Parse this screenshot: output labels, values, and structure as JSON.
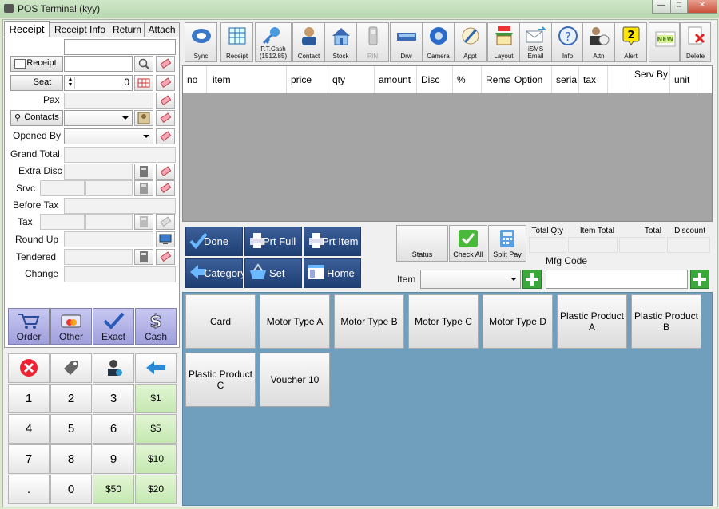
{
  "window": {
    "title": "POS Terminal (kyy)",
    "minimize": "—",
    "maximize": "□",
    "close": "✕"
  },
  "left": {
    "tabs": [
      "Receipt",
      "Receipt Info",
      "Return",
      "Attach"
    ],
    "receipt_button": "Receipt",
    "seat_button": "Seat",
    "seat_value": "0",
    "pax_label": "Pax",
    "contacts_button": "Contacts",
    "opened_by_label": "Opened By",
    "grand_total_label": "Grand Total",
    "extra_disc_label": "Extra Disc",
    "srvc_label": "Srvc",
    "before_tax_label": "Before Tax",
    "tax_label": "Tax",
    "round_up_label": "Round Up",
    "tendered_label": "Tendered",
    "change_label": "Change",
    "pay_buttons": [
      "Order",
      "Other",
      "Exact",
      "Cash"
    ],
    "keypad": [
      [
        "1",
        "2",
        "3",
        "$1"
      ],
      [
        "4",
        "5",
        "6",
        "$5"
      ],
      [
        "7",
        "8",
        "9",
        "$10"
      ],
      [
        ".",
        "0",
        "$50",
        "$20"
      ]
    ]
  },
  "toolbar": [
    {
      "label": "Sync",
      "icon": "sync-icon"
    },
    {
      "label": "Receipt",
      "icon": "receipt-icon"
    },
    {
      "label": "P.T.Cash (1512.85)",
      "icon": "key-icon"
    },
    {
      "label": "Contact",
      "icon": "contact-icon"
    },
    {
      "label": "Stock",
      "icon": "house-icon"
    },
    {
      "label": "PIN",
      "icon": "pin-device-icon",
      "disabled": true
    },
    {
      "label": "Drw",
      "icon": "drawer-icon"
    },
    {
      "label": "Camera",
      "icon": "camera-icon"
    },
    {
      "label": "Appt",
      "icon": "appointment-icon"
    },
    {
      "label": "Layout",
      "icon": "shop-icon"
    },
    {
      "label": "iSMS Email",
      "icon": "email-icon"
    },
    {
      "label": "Info",
      "icon": "info-icon"
    },
    {
      "label": "Attn",
      "icon": "attendance-icon"
    },
    {
      "label": "Alert",
      "icon": "alert-icon",
      "badge": "2"
    },
    {
      "label": "",
      "icon": "new-icon",
      "badge_text": "NEW"
    },
    {
      "label": "Delete",
      "icon": "delete-icon"
    }
  ],
  "grid": {
    "columns": [
      "no",
      "item",
      "price",
      "qty",
      "amount",
      "Disc",
      "%",
      "Rema",
      "Option",
      "seria",
      "tax",
      "",
      "Serv By",
      "unit"
    ]
  },
  "actions": {
    "done": "Done",
    "prt_full": "Prt Full",
    "prt_item": "Prt Item",
    "category": "Category",
    "set": "Set",
    "home": "Home",
    "status": "Status",
    "check_all": "Check All",
    "split_pay": "Split Pay"
  },
  "summary": {
    "total_qty": "Total Qty",
    "item_total": "Item Total",
    "total": "Total",
    "discount": "Discount",
    "mfg_code": "Mfg Code",
    "item": "Item"
  },
  "products": [
    "Card",
    "Motor Type A",
    "Motor Type B",
    "Motor Type C",
    "Motor Type D",
    "Plastic Product A",
    "Plastic Product B",
    "Plastic Product C",
    "Voucher 10"
  ],
  "colors": {
    "product_area": "#6f9fbc",
    "action_button": "#1e3f72",
    "pay_button": "#a4a4e0",
    "money_key": "#c4e8b0"
  }
}
